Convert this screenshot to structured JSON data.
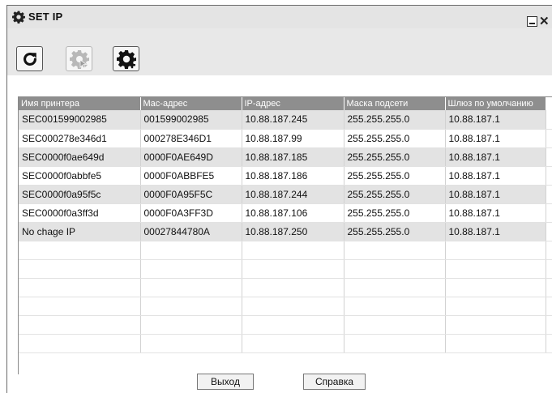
{
  "window": {
    "title": "SET IP",
    "icon": "gear-icon",
    "minimize_icon": "minimize-icon",
    "close_icon": "close-icon"
  },
  "toolbar": {
    "buttons": [
      {
        "icon": "refresh-icon",
        "enabled": true
      },
      {
        "icon": "gear-cursor-icon",
        "enabled": false
      },
      {
        "icon": "gear-add-icon",
        "enabled": true
      }
    ]
  },
  "table": {
    "columns": [
      "Имя принтера",
      "Mac-адрес",
      "IP-адрес",
      "Маска подсети",
      "Шлюз по умолчанию"
    ],
    "rows": [
      [
        "SEC001599002985",
        "001599002985",
        "10.88.187.245",
        "255.255.255.0",
        "10.88.187.1"
      ],
      [
        "SEC000278e346d1",
        "000278E346D1",
        "10.88.187.99",
        "255.255.255.0",
        "10.88.187.1"
      ],
      [
        "SEC0000f0ae649d",
        "0000F0AE649D",
        "10.88.187.185",
        "255.255.255.0",
        "10.88.187.1"
      ],
      [
        "SEC0000f0abbfe5",
        "0000F0ABBFE5",
        "10.88.187.186",
        "255.255.255.0",
        "10.88.187.1"
      ],
      [
        "SEC0000f0a95f5c",
        "0000F0A95F5C",
        "10.88.187.244",
        "255.255.255.0",
        "10.88.187.1"
      ],
      [
        "SEC0000f0a3ff3d",
        "0000F0A3FF3D",
        "10.88.187.106",
        "255.255.255.0",
        "10.88.187.1"
      ],
      [
        "No chage IP",
        "00027844780A",
        "10.88.187.250",
        "255.255.255.0",
        "10.88.187.1"
      ]
    ],
    "empty_rows": 6
  },
  "footer": {
    "exit_label": "Выход",
    "help_label": "Справка"
  },
  "colors": {
    "header_bg": "#8e8e8e",
    "row_shade": "#e3e3e3",
    "titlebar_bg": "#e4e4e4"
  }
}
